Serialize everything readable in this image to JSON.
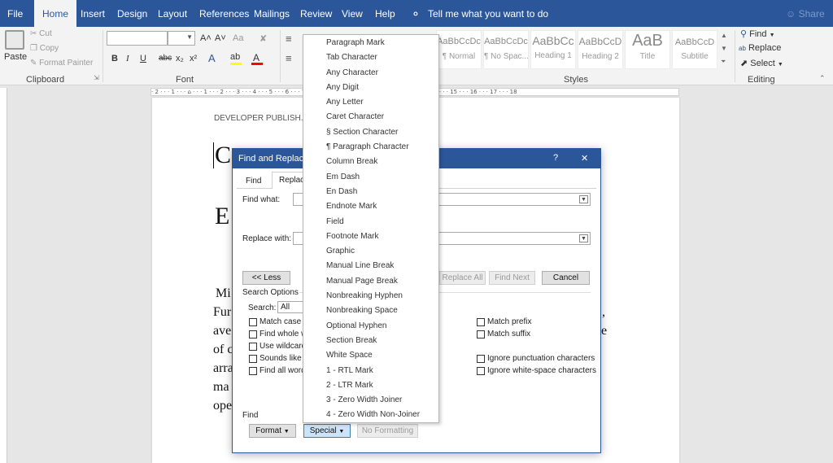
{
  "tabs": [
    "File",
    "Home",
    "Insert",
    "Design",
    "Layout",
    "References",
    "Mailings",
    "Review",
    "View",
    "Help"
  ],
  "tell_me": "Tell me what you want to do",
  "share": "Share",
  "clipboard": {
    "paste": "Paste",
    "cut": "Cut",
    "copy": "Copy",
    "format_painter": "Format Painter",
    "label": "Clipboard"
  },
  "font": {
    "label": "Font",
    "bold": "B",
    "italic": "I",
    "underline": "U",
    "strike": "abc",
    "sub": "x₂",
    "sup": "x²",
    "grow": "A˄",
    "shrink": "A˅",
    "case": "Aa"
  },
  "styles": {
    "label": "Styles",
    "items": [
      {
        "preview": "AaBbCcDc",
        "name": "¶ Normal"
      },
      {
        "preview": "AaBbCcDc",
        "name": "¶ No Spac..."
      },
      {
        "preview": "AaBbCc",
        "name": "Heading 1"
      },
      {
        "preview": "AaBbCcD",
        "name": "Heading 2"
      },
      {
        "preview": "AaB",
        "name": "Title"
      },
      {
        "preview": "AaBbCcD",
        "name": "Subtitle"
      }
    ]
  },
  "editing": {
    "find": "Find",
    "replace": "Replace",
    "select": "Select",
    "label": "Editing"
  },
  "ruler": "· 2 · · · 1 · · · ⌂ · · · 1 · · · 2 · · · 3 · · · 4 · · · 5 · · · 6 · · · 7 · · · 8 · · · 9 · · · 10 · · · 11 · · · 12 · · · 13 · · · 14 · · · 15 · · · 16 · · · 17 · · · 18",
  "document": {
    "header": "DEVELOPER PUBLISH.CO",
    "big1": "C",
    "big2": "E",
    "lines": [
      "Mi",
      "Fur",
      "ave",
      "of c",
      "arra",
      "ma",
      "ope"
    ],
    "right": [
      ",",
      "e"
    ]
  },
  "dialog": {
    "title": "Find and Replace",
    "help": "?",
    "close": "✕",
    "tab_find": "Find",
    "tab_replace": "Replace",
    "find_what": "Find what:",
    "replace_with": "Replace with:",
    "less": "<< Less",
    "replace_all": "Replace All",
    "find_next": "Find Next",
    "cancel": "Cancel",
    "search_options": "Search Options",
    "search_label": "Search:",
    "search_value": "All",
    "options_left": [
      "Match case",
      "Find whole w",
      "Use wildcard",
      "Sounds like (",
      "Find all word"
    ],
    "options_right": [
      "Match prefix",
      "Match suffix",
      "Ignore punctuation characters",
      "Ignore white-space characters"
    ],
    "find_section": "Find",
    "format": "Format",
    "special": "Special",
    "no_formatting": "No Formatting"
  },
  "special_menu": [
    "Paragraph Mark",
    "Tab Character",
    "Any Character",
    "Any Digit",
    "Any Letter",
    "Caret Character",
    "§ Section Character",
    "¶ Paragraph Character",
    "Column Break",
    "Em Dash",
    "En Dash",
    "Endnote Mark",
    "Field",
    "Footnote Mark",
    "Graphic",
    "Manual Line Break",
    "Manual Page Break",
    "Nonbreaking Hyphen",
    "Nonbreaking Space",
    "Optional Hyphen",
    "Section Break",
    "White Space",
    "1 - RTL Mark",
    "2 - LTR Mark",
    "3 - Zero Width Joiner",
    "4 - Zero Width Non-Joiner"
  ],
  "colors": {
    "accent": "#2b579a",
    "highlight": "#ffff00",
    "font_color": "#ff0000",
    "button_active": "#cce4f7"
  }
}
